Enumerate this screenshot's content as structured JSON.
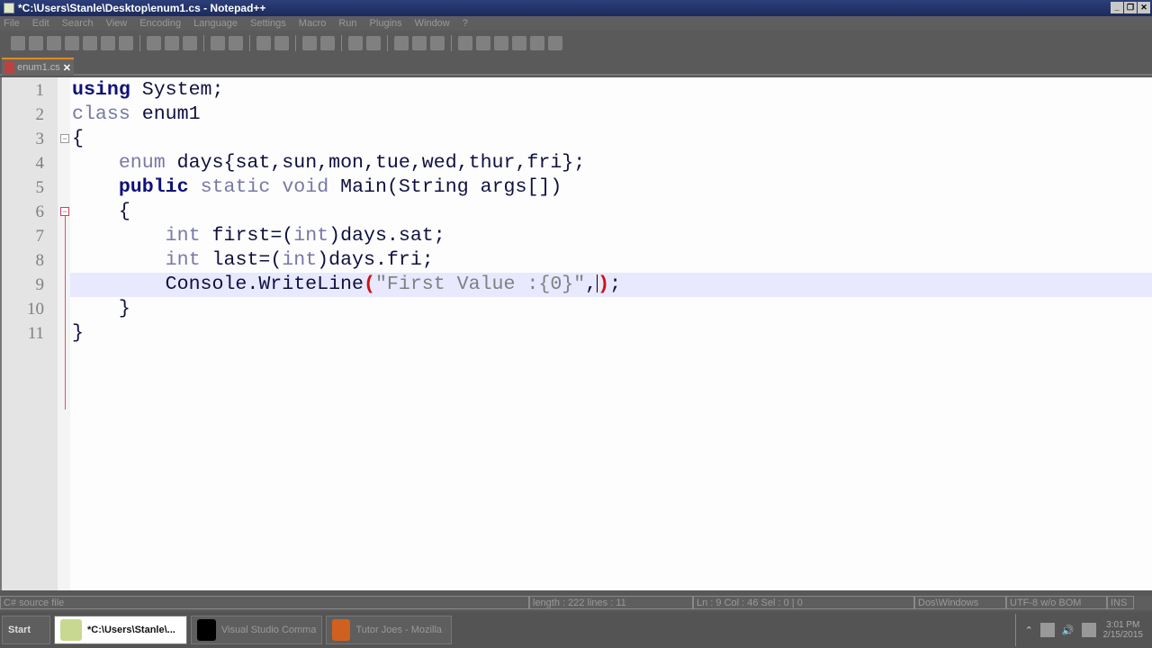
{
  "window": {
    "title": "*C:\\Users\\Stanle\\Desktop\\enum1.cs - Notepad++"
  },
  "menu": [
    "File",
    "Edit",
    "Search",
    "View",
    "Encoding",
    "Language",
    "Settings",
    "Macro",
    "Run",
    "Plugins",
    "Window",
    "?"
  ],
  "toolbar_icons": [
    "new",
    "open",
    "save",
    "save-all",
    "close",
    "close-all",
    "print",
    "cut",
    "copy",
    "paste",
    "undo",
    "redo",
    "find",
    "replace",
    "zoom-in",
    "zoom-out",
    "sync-v",
    "sync-h",
    "wrap",
    "indent-guide",
    "show-all",
    "record-macro",
    "stop-macro",
    "play-macro",
    "run-macro-multiple",
    "save-macro",
    "spell-check"
  ],
  "tab": {
    "label": "enum1.cs",
    "close": "✕"
  },
  "code": [
    {
      "n": "1",
      "tokens": [
        {
          "c": "kw",
          "t": "using"
        },
        {
          "c": "",
          "t": " System;"
        }
      ]
    },
    {
      "n": "2",
      "tokens": [
        {
          "c": "ty",
          "t": "class"
        },
        {
          "c": "",
          "t": " enum1"
        }
      ]
    },
    {
      "n": "3",
      "tokens": [
        {
          "c": "",
          "t": "{"
        }
      ]
    },
    {
      "n": "4",
      "tokens": [
        {
          "c": "",
          "t": "    "
        },
        {
          "c": "ty",
          "t": "enum"
        },
        {
          "c": "",
          "t": " days{sat,sun,mon,tue,wed,thur,fri};"
        }
      ]
    },
    {
      "n": "5",
      "tokens": [
        {
          "c": "",
          "t": "    "
        },
        {
          "c": "kw",
          "t": "public"
        },
        {
          "c": "",
          "t": " "
        },
        {
          "c": "ty",
          "t": "static"
        },
        {
          "c": "",
          "t": " "
        },
        {
          "c": "ty",
          "t": "void"
        },
        {
          "c": "",
          "t": " Main(String args[])"
        }
      ]
    },
    {
      "n": "6",
      "tokens": [
        {
          "c": "",
          "t": "    {"
        }
      ]
    },
    {
      "n": "7",
      "tokens": [
        {
          "c": "",
          "t": "        "
        },
        {
          "c": "ty",
          "t": "int"
        },
        {
          "c": "",
          "t": " first=("
        },
        {
          "c": "ty",
          "t": "int"
        },
        {
          "c": "",
          "t": ")days.sat;"
        }
      ]
    },
    {
      "n": "8",
      "tokens": [
        {
          "c": "",
          "t": "        "
        },
        {
          "c": "ty",
          "t": "int"
        },
        {
          "c": "",
          "t": " last=("
        },
        {
          "c": "ty",
          "t": "int"
        },
        {
          "c": "",
          "t": ")days.fri;"
        }
      ]
    },
    {
      "n": "9",
      "current": true,
      "tokens": [
        {
          "c": "",
          "t": "        Console.WriteLine"
        },
        {
          "c": "par",
          "t": "("
        },
        {
          "c": "str",
          "t": "\"First Value :{0}\""
        },
        {
          "c": "",
          "t": ","
        },
        {
          "c": "caret",
          "t": ""
        },
        {
          "c": "par",
          "t": ")"
        },
        {
          "c": "",
          "t": ";"
        }
      ]
    },
    {
      "n": "10",
      "tokens": [
        {
          "c": "",
          "t": "    }"
        }
      ]
    },
    {
      "n": "11",
      "tokens": [
        {
          "c": "",
          "t": "}"
        }
      ]
    }
  ],
  "status": {
    "type": "C# source file",
    "length": "length : 222   lines : 11",
    "position": "Ln : 9   Col : 46   Sel : 0 | 0",
    "eol": "Dos\\Windows",
    "encoding": "UTF-8 w/o BOM",
    "mode": "INS"
  },
  "taskbar": {
    "start": "Start",
    "tasks": [
      {
        "label": "*C:\\Users\\Stanle\\...",
        "active": true,
        "icon": "notepadpp-icon"
      },
      {
        "label": "Visual Studio Comman...",
        "icon": "cmd-icon"
      },
      {
        "label": "Tutor Joes - Mozilla Fi...",
        "icon": "firefox-icon"
      }
    ],
    "time": "3:01 PM",
    "date": "2/15/2015"
  }
}
